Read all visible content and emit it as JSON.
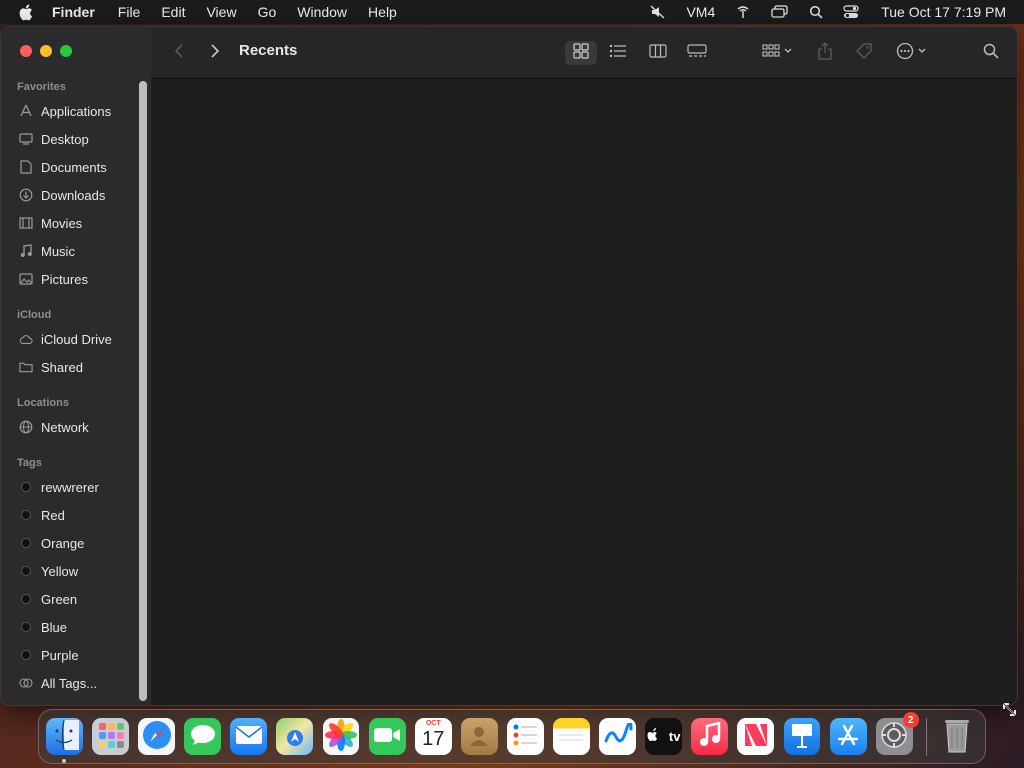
{
  "menubar": {
    "app_name": "Finder",
    "menus": [
      "File",
      "Edit",
      "View",
      "Go",
      "Window",
      "Help"
    ],
    "status": {
      "vm_label": "VM4",
      "clock": "Tue Oct 17  7:19 PM"
    }
  },
  "window": {
    "title": "Recents",
    "sidebar": {
      "favorites_header": "Favorites",
      "favorites": [
        {
          "label": "Applications",
          "icon": "applications-icon"
        },
        {
          "label": "Desktop",
          "icon": "desktop-icon"
        },
        {
          "label": "Documents",
          "icon": "document-icon"
        },
        {
          "label": "Downloads",
          "icon": "downloads-icon"
        },
        {
          "label": "Movies",
          "icon": "movies-icon"
        },
        {
          "label": "Music",
          "icon": "music-icon"
        },
        {
          "label": "Pictures",
          "icon": "pictures-icon"
        }
      ],
      "icloud_header": "iCloud",
      "icloud": [
        {
          "label": "iCloud Drive",
          "icon": "cloud-icon"
        },
        {
          "label": "Shared",
          "icon": "shared-folder-icon"
        }
      ],
      "locations_header": "Locations",
      "locations": [
        {
          "label": "Network",
          "icon": "network-icon"
        }
      ],
      "tags_header": "Tags",
      "tags": [
        "rewwrerer",
        "Red",
        "Orange",
        "Yellow",
        "Green",
        "Blue",
        "Purple"
      ],
      "all_tags": "All Tags..."
    }
  },
  "dock": {
    "apps": [
      "Finder",
      "Launchpad",
      "Safari",
      "Messages",
      "Mail",
      "Maps",
      "Photos",
      "FaceTime",
      "Calendar",
      "Contacts",
      "Reminders",
      "Notes",
      "Freeform",
      "TV",
      "Music",
      "News",
      "Keynote",
      "App Store",
      "System Settings"
    ],
    "calendar": {
      "month": "OCT",
      "day": "17"
    },
    "settings_badge": "2",
    "tv_label": "tv"
  },
  "colors": {
    "traffic_red": "#ff5f57",
    "traffic_yellow": "#febc2e",
    "traffic_green": "#28c840",
    "badge": "#ff3b30"
  }
}
